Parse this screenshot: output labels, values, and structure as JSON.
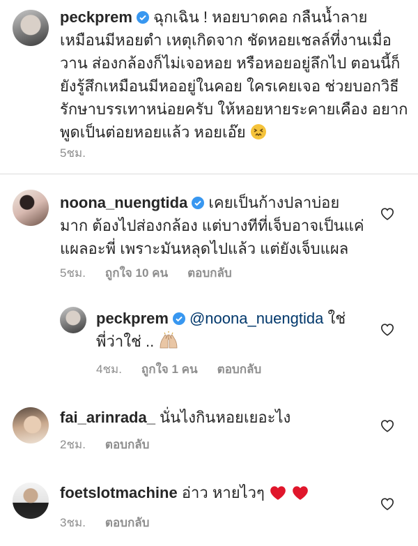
{
  "comments": [
    {
      "username": "peckprem",
      "verified": true,
      "lines": [
        "ฉุกเฉิน ! หอยบาดคอ กลืนน้ำลาย",
        "เหมือนมีหอยตำ เหตุเกิดจาก ชัดหอยเชลล์ที่งานเมื่อ",
        "วาน ส่องกล้องก็ไม่เจอหอย หรือหอยอยู่ลึกไป ตอนนี้ก็",
        "ยังรู้สึกเหมือนมีหออยู่ในคอย ใครเคยเจอ ช่วยบอกวิธี",
        "รักษาบรรเทาหน่อยครับ ให้หอยหายระคายเคือง อยาก",
        "พูดเป็นต่อยหอยแล้ว หอยเอ๊ย"
      ],
      "emoji": "confounded-face",
      "time": "5ชม."
    },
    {
      "username": "noona_nuengtida",
      "verified": true,
      "lines": [
        "เคยเป็นก้างปลาบ่อย",
        "มาก ต้องไปส่องกล้อง แต่บางทีที่เจ็บอาจเป็นแค่",
        "แผลอะพี่ เพราะมันหลุดไปแล้ว แต่ยังเจ็บแผล"
      ],
      "time": "5ชม.",
      "likes": "ถูกใจ 10 คน",
      "reply": "ตอบกลับ"
    },
    {
      "username": "peckprem",
      "verified": true,
      "mention": "@noona_nuengtida",
      "text_after": "ใช่",
      "line2": "พี่ว่าใช่ ..",
      "emoji": "raising-hands",
      "time": "4ชม.",
      "likes": "ถูกใจ 1 คน",
      "reply": "ตอบกลับ"
    },
    {
      "username": "fai_arinrada_",
      "text": "นั่นไงกินหอยเยอะไง",
      "time": "2ชม.",
      "reply": "ตอบกลับ"
    },
    {
      "username": "foetslotmachine",
      "text": "อ่าว หายไวๆ",
      "emoji": "red-heart-x2",
      "time": "3ชม.",
      "reply": "ตอบกลับ"
    }
  ],
  "colors": {
    "text": "#262626",
    "secondary": "#8e8e8e",
    "verified": "#3897f0",
    "mention": "#00376b",
    "heart_emoji": "#e0162b"
  }
}
